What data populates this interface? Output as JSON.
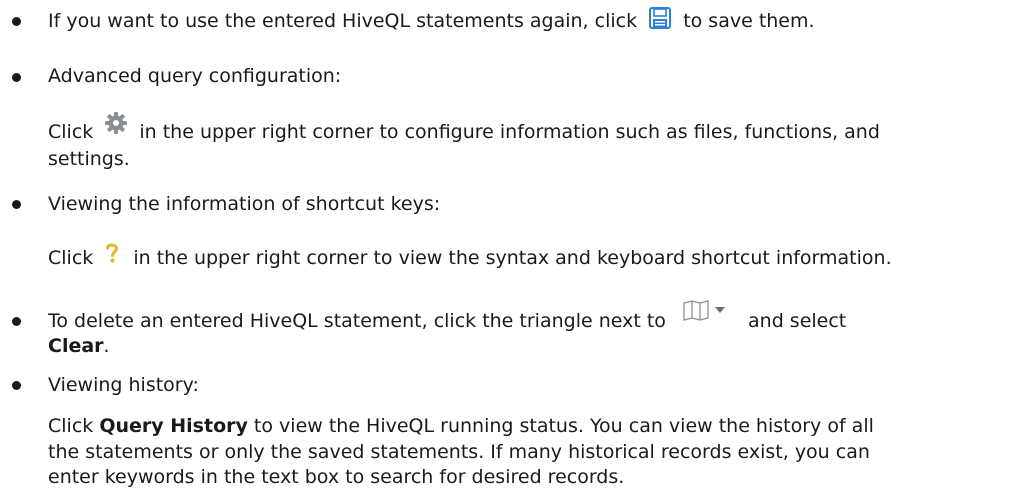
{
  "items": [
    {
      "pre": "If you want to use the entered HiveQL statements again, click",
      "icon": "save-icon",
      "post": "to save them."
    },
    {
      "title": "Advanced query configuration:",
      "pre": "Click",
      "icon": "gear-icon",
      "post": "in the upper right corner to configure information such as files, functions, and",
      "post2": "settings."
    },
    {
      "title": "Viewing the information of shortcut keys:",
      "pre": "Click",
      "icon": "question-icon",
      "post": "in the upper right corner to view the syntax and keyboard shortcut information."
    },
    {
      "pre": "To delete an entered HiveQL statement, click the triangle next to",
      "icon": "book-icon",
      "post": "and select",
      "bold": "Clear",
      "tail": "."
    },
    {
      "title": "Viewing history:",
      "pre": "Click",
      "bold": "Query History",
      "lines": [
        " to view the HiveQL running status. You can view the history of all",
        "the statements or only the saved statements. If many historical records exist, you can",
        "enter keywords in the text box to search for desired records."
      ]
    }
  ],
  "colors": {
    "text": "#1a1a1a",
    "icon_blue": "#2f7fd8",
    "icon_gray": "#8a8f96",
    "icon_gold": "#e0b820"
  }
}
